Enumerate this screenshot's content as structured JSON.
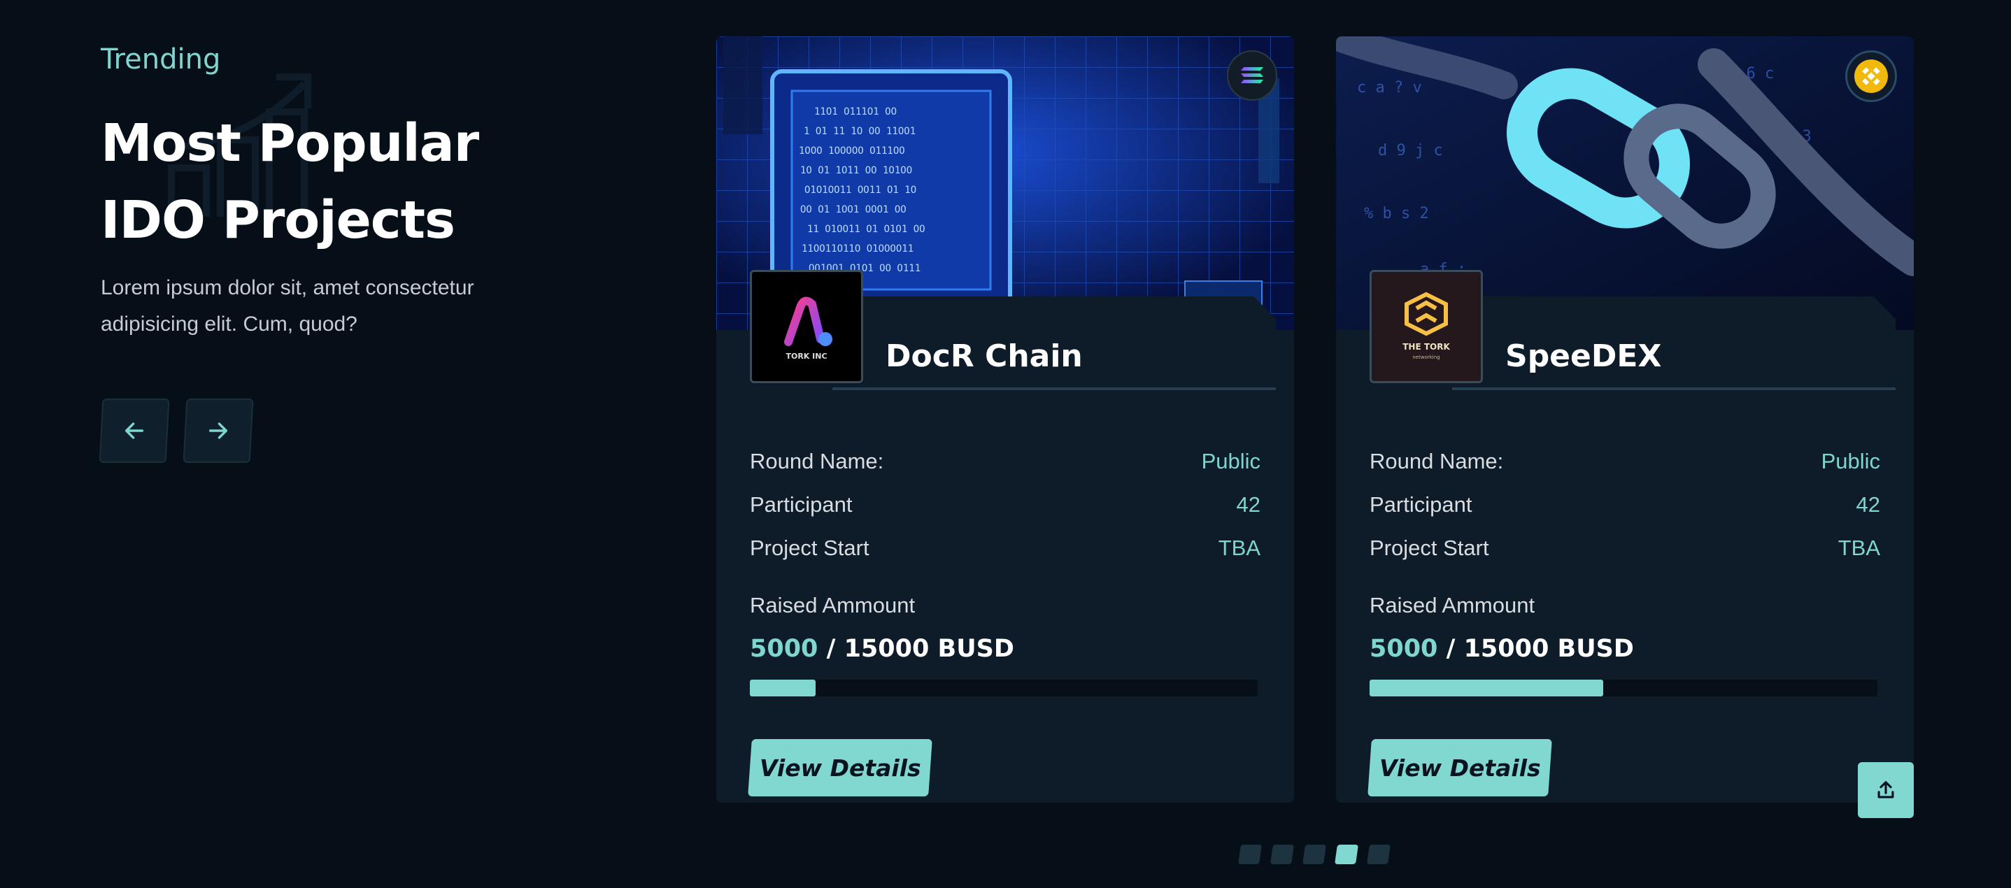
{
  "intro": {
    "tag": "Trending",
    "title": "Most Popular IDO Projects",
    "description": "Lorem ipsum dolor sit, amet consectetur adipisicing elit. Cum, quod?",
    "prev_icon": "arrow-left-icon",
    "next_icon": "arrow-right-icon"
  },
  "cards": [
    {
      "name": "DocR Chain",
      "logo_text": "TORK INC",
      "chain_icon": "solana-icon",
      "round_label": "Round Name:",
      "round_value": "Public",
      "participant_label": "Participant",
      "participant_value": "42",
      "start_label": "Project Start",
      "start_value": "TBA",
      "raised_label": "Raised Ammount",
      "raised_current": "5000",
      "raised_total": " / 15000 BUSD",
      "progress_fraction": 0.13,
      "button": "View Details"
    },
    {
      "name": "SpeeDEX",
      "logo_text": "THE TORK",
      "logo_subtext": "networking",
      "chain_icon": "binance-icon",
      "round_label": "Round Name:",
      "round_value": "Public",
      "participant_label": "Participant",
      "participant_value": "42",
      "start_label": "Project Start",
      "start_value": "TBA",
      "raised_label": "Raised Ammount",
      "raised_current": "5000",
      "raised_total": " / 15000 BUSD",
      "progress_fraction": 0.46,
      "button": "View Details"
    }
  ],
  "pagination": {
    "count": 5,
    "active_index": 3
  },
  "share_icon": "share-upload-icon",
  "colors": {
    "background": "#060f18",
    "card": "#0e1b28",
    "accent": "#80d8d0"
  }
}
